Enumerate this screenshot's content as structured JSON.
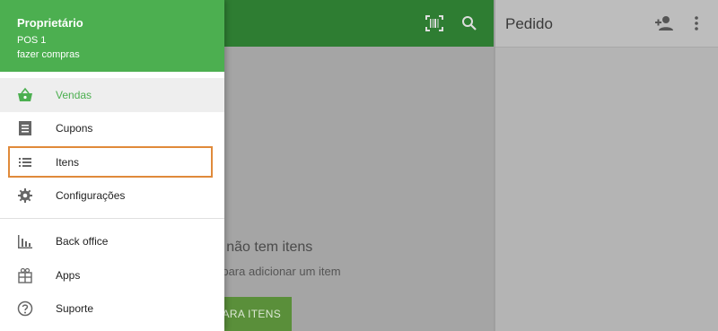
{
  "topbar": {
    "right_title": "Pedido",
    "icons": {
      "barcode": "barcode-icon",
      "search": "search-icon",
      "add_customer": "add-person-icon",
      "more": "more-vert-icon"
    }
  },
  "main": {
    "empty_title": "da não tem itens",
    "empty_subtitle": "ns para adicionar um item",
    "add_button_label": "PARA ITENS"
  },
  "drawer": {
    "owner": "Proprietário",
    "pos": "POS 1",
    "shop": "fazer compras",
    "items": [
      {
        "label": "Vendas",
        "icon": "basket-icon"
      },
      {
        "label": "Cupons",
        "icon": "receipt-icon"
      },
      {
        "label": "Itens",
        "icon": "list-icon"
      },
      {
        "label": "Configurações",
        "icon": "gear-icon"
      },
      {
        "label": "Back office",
        "icon": "bar-chart-icon"
      },
      {
        "label": "Apps",
        "icon": "apps-gift-icon"
      },
      {
        "label": "Suporte",
        "icon": "help-icon"
      }
    ]
  },
  "colors": {
    "accent": "#4caf50",
    "header_dark": "#2e7d32",
    "highlight": "#e08a3a"
  }
}
